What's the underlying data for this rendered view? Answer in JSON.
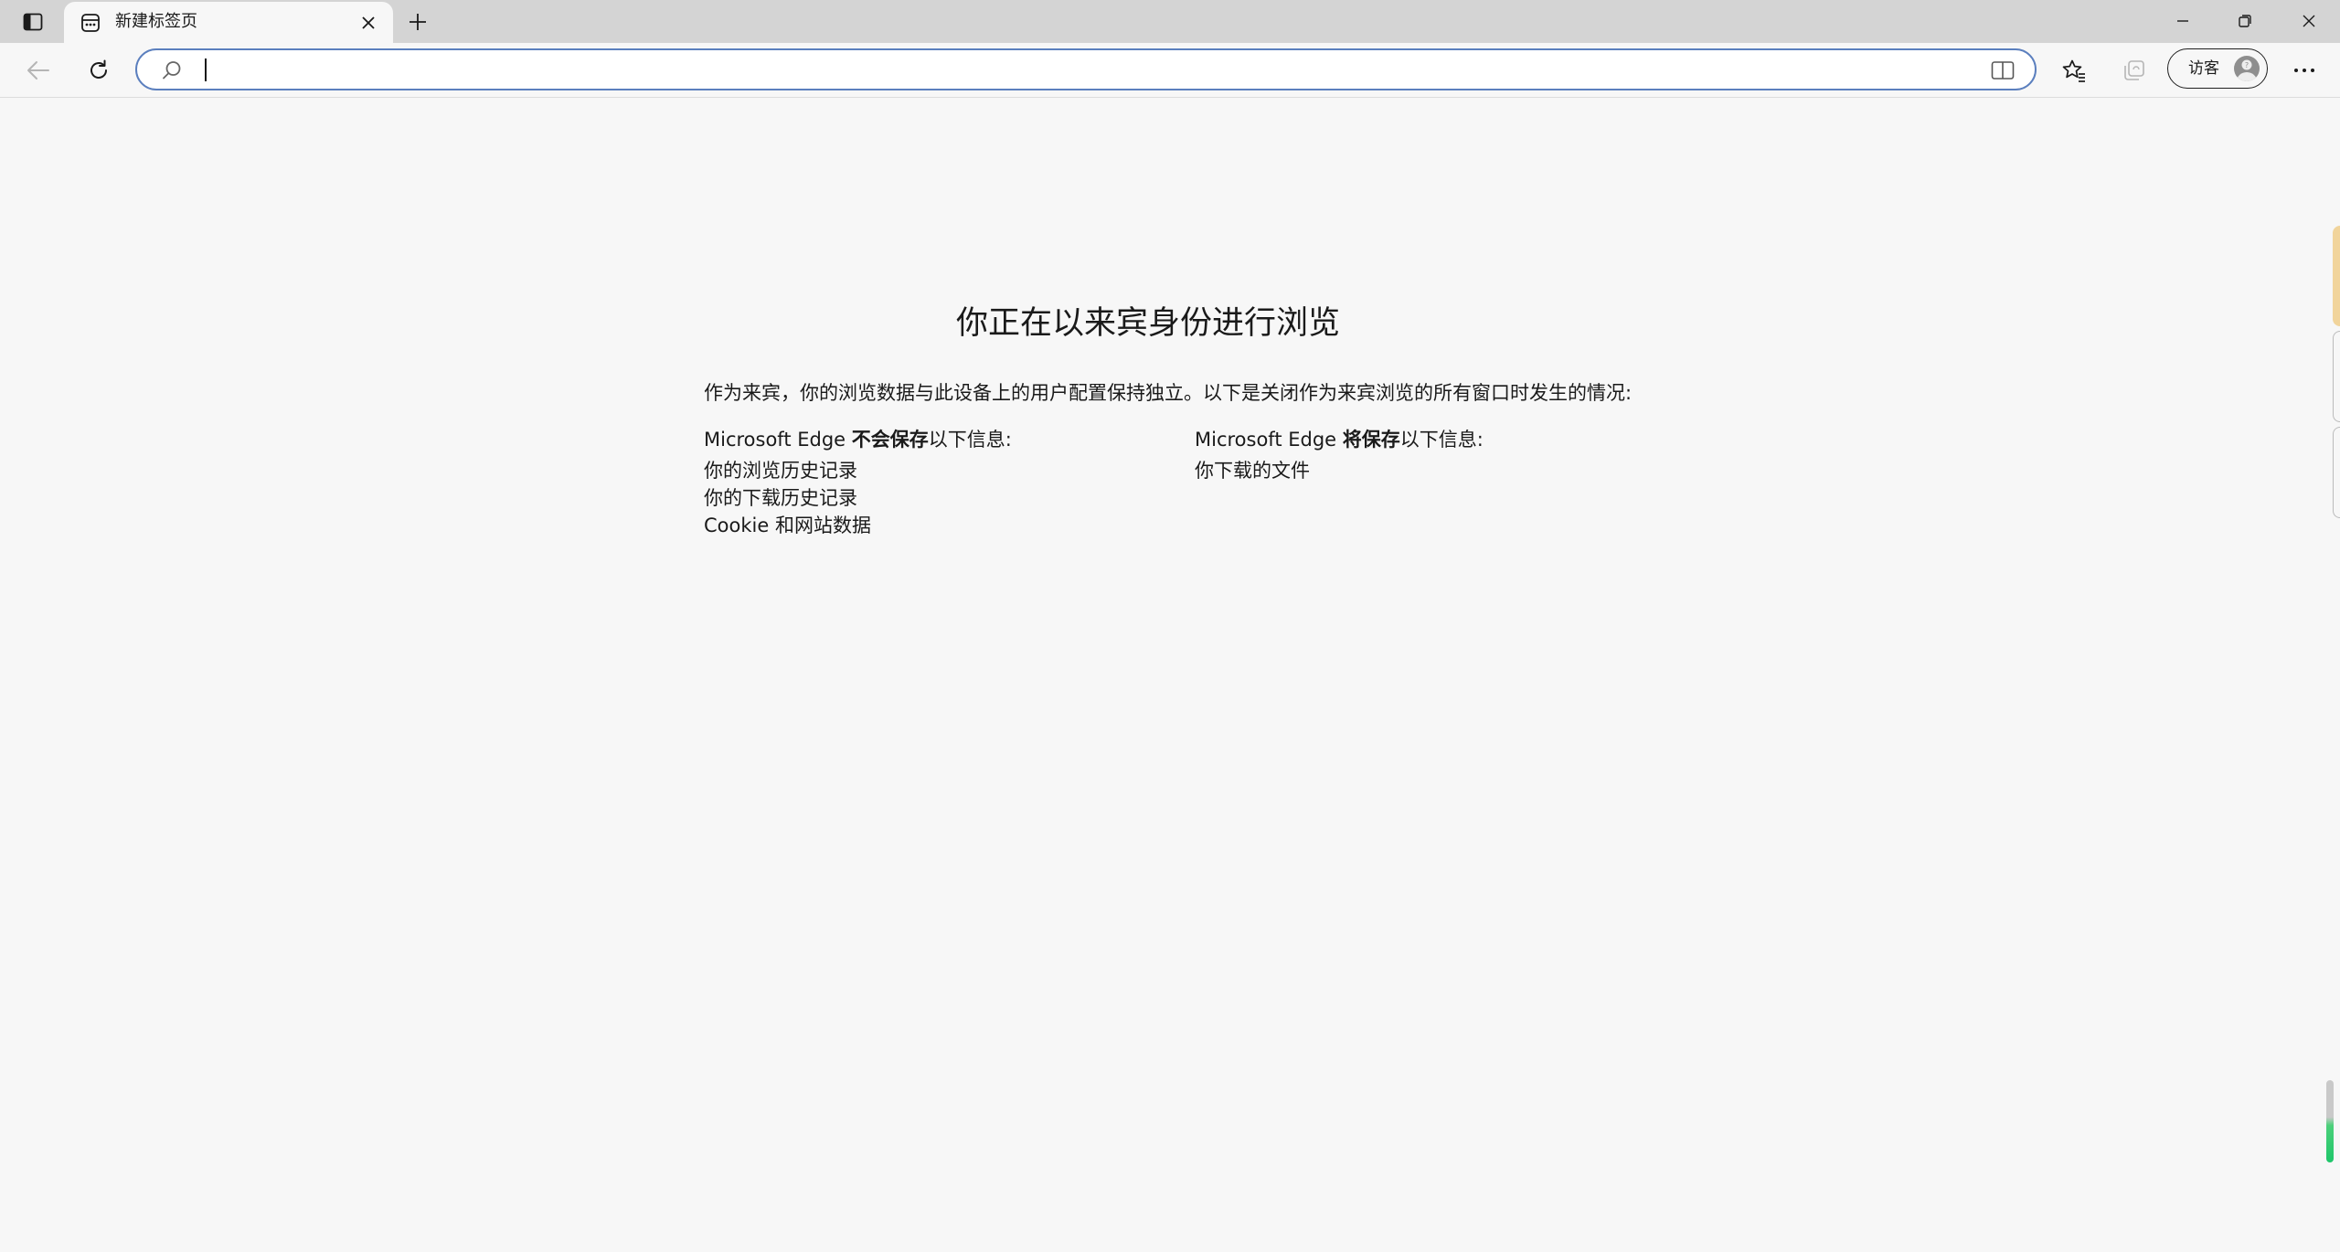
{
  "tab": {
    "title": "新建标签页"
  },
  "toolbar": {
    "address_value": "",
    "address_placeholder": "",
    "guest_label": "访客"
  },
  "page": {
    "title": "你正在以来宾身份进行浏览",
    "description": "作为来宾，你的浏览数据与此设备上的用户配置保持独立。以下是关闭作为来宾浏览的所有窗口时发生的情况:",
    "not_saved": {
      "prefix": "Microsoft Edge ",
      "emphasis": "不会保存",
      "suffix": "以下信息:",
      "items": [
        "你的浏览历史记录",
        "你的下载历史记录",
        "Cookie 和网站数据"
      ]
    },
    "saved": {
      "prefix": "Microsoft Edge ",
      "emphasis": "将保存",
      "suffix": "以下信息:",
      "items": [
        "你下载的文件"
      ]
    }
  },
  "colors": {
    "accent": "#5b7fbe",
    "background": "#f7f7f7",
    "tabstrip": "#d4d4d4"
  },
  "icons": {
    "tab_actions": "tab-actions-icon",
    "favicon": "new-tab-page-icon",
    "close": "close-icon",
    "new_tab": "plus-icon",
    "minimize": "minimize-icon",
    "restore": "restore-icon",
    "window_close": "close-icon",
    "back": "back-arrow-icon",
    "refresh": "refresh-icon",
    "search": "search-icon",
    "split_screen": "split-screen-icon",
    "favorites": "favorites-icon",
    "collections": "collections-icon",
    "guest_avatar": "guest-avatar-icon",
    "more": "more-icon"
  }
}
